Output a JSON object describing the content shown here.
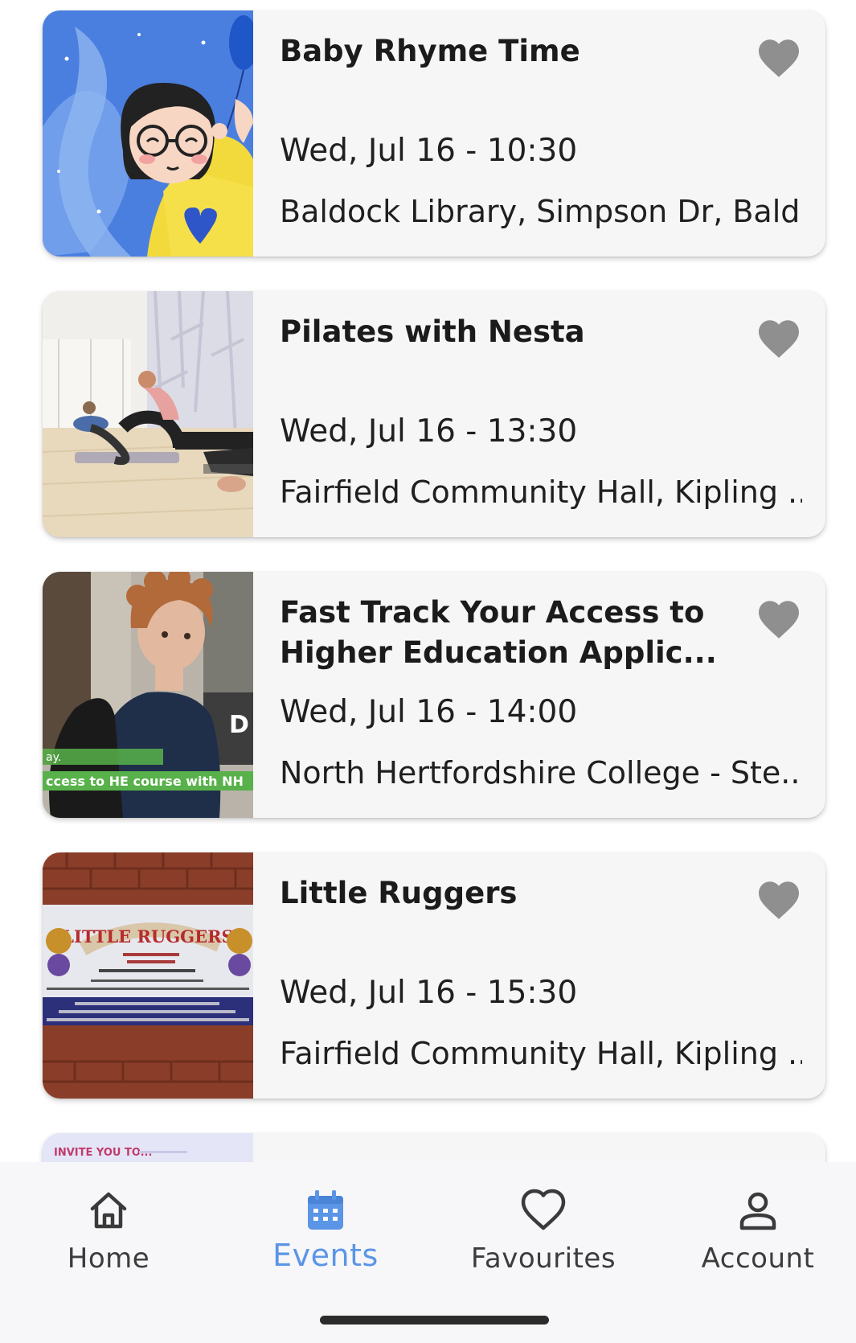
{
  "events": [
    {
      "title": "Baby Rhyme Time",
      "datetime": "Wed, Jul 16 - 10:30",
      "venue": "Baldock Library, Simpson Dr, Bald...",
      "favourited": false,
      "thumb_icon": "cartoon-girl-image"
    },
    {
      "title": "Pilates with Nesta",
      "datetime": "Wed, Jul 16 - 13:30",
      "venue": "Fairfield Community Hall, Kipling ...",
      "favourited": false,
      "thumb_icon": "pilates-class-photo"
    },
    {
      "title": "Fast Track Your Access to Higher Education Applic...",
      "datetime": "Wed, Jul 16 - 14:00",
      "venue": "North Hertfordshire College - Ste...",
      "favourited": false,
      "thumb_icon": "student-photo",
      "thumb_caption": "ccess to HE course with NH",
      "thumb_side_text": "ay.",
      "thumb_letter": "D"
    },
    {
      "title": "Little Ruggers",
      "datetime": "Wed, Jul 16 - 15:30",
      "venue": "Fairfield Community Hall, Kipling ...",
      "favourited": false,
      "thumb_icon": "little-ruggers-banner-photo",
      "thumb_banner_title": "LITTLE RUGGERS"
    },
    {
      "thumb_icon": "invite-poster-image",
      "thumb_text": "INVITE YOU TO..."
    }
  ],
  "nav": {
    "items": [
      {
        "label": "Home",
        "icon": "home-icon",
        "active": false
      },
      {
        "label": "Events",
        "icon": "calendar-icon",
        "active": true
      },
      {
        "label": "Favourites",
        "icon": "heart-outline-icon",
        "active": false
      },
      {
        "label": "Account",
        "icon": "person-icon",
        "active": false
      }
    ]
  },
  "colors": {
    "accent": "#5b95e6",
    "heart": "#8f8f8f",
    "card_bg": "#f6f6f6",
    "nav_bg": "#f7f7f9"
  }
}
